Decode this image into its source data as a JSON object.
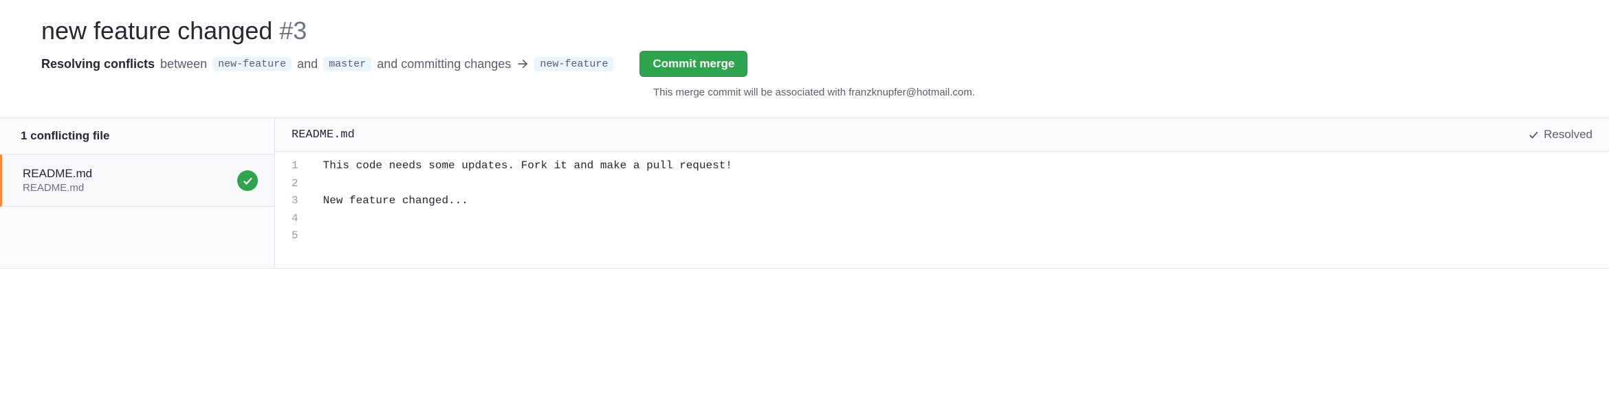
{
  "header": {
    "title": "new feature changed",
    "issue_number": "#3",
    "resolving_label": "Resolving conflicts",
    "between_text": "between",
    "source_branch": "new-feature",
    "and_text": "and",
    "target_branch": "master",
    "commit_text": "and committing changes",
    "result_branch": "new-feature",
    "commit_button": "Commit merge",
    "association_prefix": "This merge commit will be associated with ",
    "association_email": "franzknupfer@hotmail.com",
    "association_suffix": "."
  },
  "sidebar": {
    "heading": "1 conflicting file",
    "file": {
      "name": "README.md",
      "path": "README.md"
    }
  },
  "content": {
    "filename": "README.md",
    "resolved_label": "Resolved",
    "lines": [
      "This code needs some updates. Fork it and make a pull request!",
      "",
      "New feature changed...",
      "",
      ""
    ]
  }
}
